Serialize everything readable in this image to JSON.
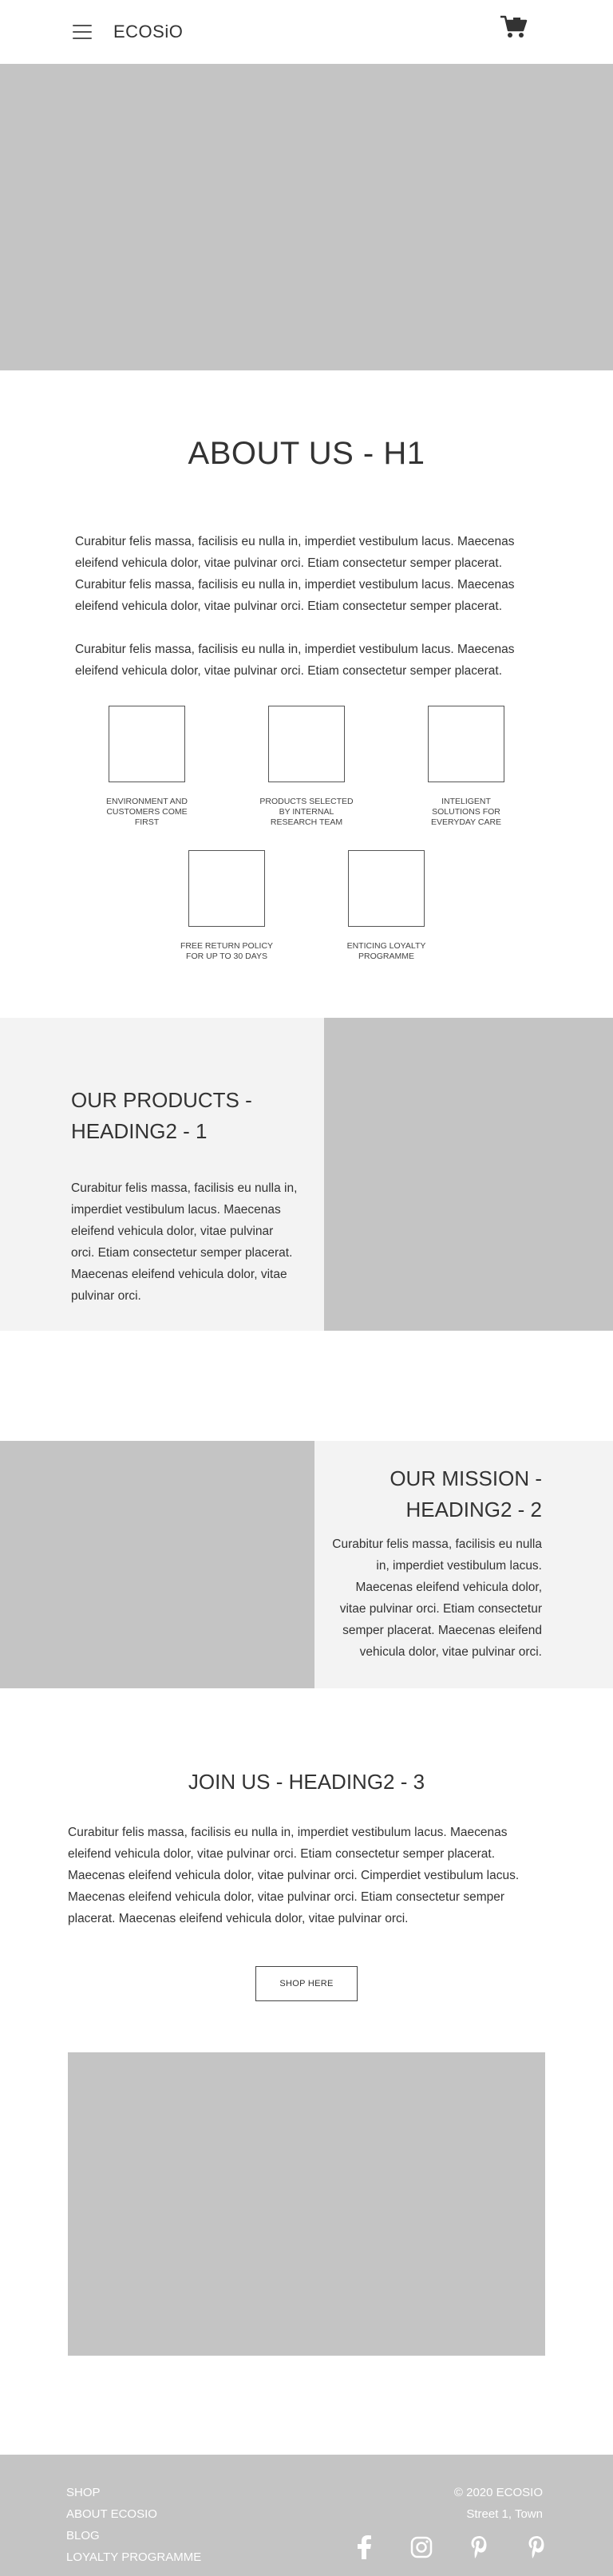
{
  "header": {
    "logo": "ECOSiO"
  },
  "about": {
    "title": "ABOUT US - H1",
    "paragraph_1": "Curabitur felis massa, facilisis eu nulla in, imperdiet vestibulum lacus. Maecenas eleifend vehicula dolor, vitae pulvinar orci. Etiam consectetur semper placerat. Curabitur felis massa, facilisis eu nulla in, imperdiet vestibulum lacus. Maecenas eleifend vehicula dolor, vitae pulvinar orci. Etiam consectetur semper placerat.",
    "paragraph_2": "Curabitur felis massa, facilisis eu nulla in, imperdiet vestibulum lacus. Maecenas eleifend vehicula dolor, vitae pulvinar orci. Etiam consectetur semper placerat.",
    "features": [
      {
        "label": "ENVIRONMENT AND CUSTOMERS COME FIRST"
      },
      {
        "label": "PRODUCTS SELECTED BY INTERNAL RESEARCH TEAM"
      },
      {
        "label": "INTELIGENT SOLUTIONS FOR EVERYDAY CARE"
      },
      {
        "label": "FREE RETURN POLICY FOR UP TO 30 DAYS"
      },
      {
        "label": "ENTICING LOYALTY PROGRAMME"
      }
    ]
  },
  "products": {
    "heading": "OUR PRODUCTS - HEADING2 - 1",
    "body": "Curabitur felis massa, facilisis eu nulla in, imperdiet vestibulum lacus. Maecenas eleifend vehicula dolor, vitae pulvinar orci. Etiam consectetur semper placerat. Maecenas eleifend vehicula dolor, vitae pulvinar orci."
  },
  "mission": {
    "heading": "OUR MISSION - HEADING2 - 2",
    "body": "Curabitur felis massa, facilisis eu nulla in, imperdiet vestibulum lacus. Maecenas eleifend vehicula dolor, vitae pulvinar orci. Etiam consectetur semper placerat. Maecenas eleifend vehicula dolor, vitae pulvinar orci."
  },
  "join": {
    "heading": "JOIN US - HEADING2 - 3",
    "body": "Curabitur felis massa, facilisis eu nulla in, imperdiet vestibulum lacus. Maecenas eleifend vehicula dolor, vitae pulvinar orci. Etiam consectetur semper placerat. Maecenas eleifend vehicula dolor, vitae pulvinar orci. Cimperdiet vestibulum lacus. Maecenas eleifend vehicula dolor, vitae pulvinar orci. Etiam consectetur semper placerat. Maecenas eleifend vehicula dolor, vitae pulvinar orci.",
    "button_label": "SHOP HERE"
  },
  "footer": {
    "nav": [
      "SHOP",
      "ABOUT ECOSIO",
      "BLOG",
      "LOYALTY PROGRAMME"
    ],
    "copyright": "© 2020 ECOSIO",
    "address": "Street 1, Town",
    "social_icons": [
      "facebook-icon",
      "instagram-icon",
      "pinterest-icon",
      "pinterest-icon"
    ]
  },
  "colors": {
    "placeholder_gray": "#c4c4c4",
    "panel_gray": "#f3f3f3",
    "text": "#333333",
    "footer_text": "#ffffff"
  }
}
